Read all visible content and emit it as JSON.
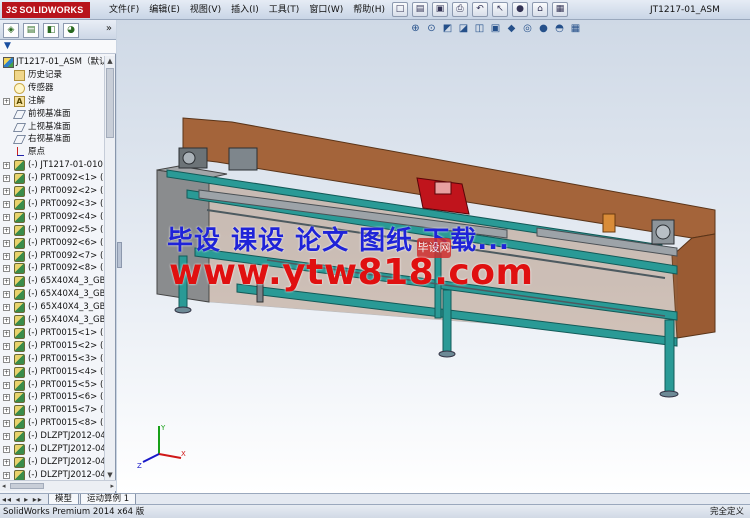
{
  "app": {
    "brand": "SOLIDWORKS",
    "doc_title": "JT1217-01_ASM"
  },
  "menu": [
    "文件(F)",
    "编辑(E)",
    "视图(V)",
    "插入(I)",
    "工具(T)",
    "窗口(W)",
    "帮助(H)"
  ],
  "title_toolbar": [
    {
      "icon": "new-document-icon",
      "glyph": "□"
    },
    {
      "icon": "open-folder-icon",
      "glyph": "▤"
    },
    {
      "icon": "save-icon",
      "glyph": "▣"
    },
    {
      "icon": "print-icon",
      "glyph": "⎙"
    },
    {
      "icon": "undo-icon",
      "glyph": "↶"
    },
    {
      "icon": "select-pointer-icon",
      "glyph": "↖"
    },
    {
      "icon": "traffic-light-icon",
      "glyph": "●"
    },
    {
      "icon": "rebuild-icon",
      "glyph": "⌂"
    },
    {
      "icon": "options-icon",
      "glyph": "▦"
    }
  ],
  "panel_tabs": [
    {
      "name": "feature-manager-tab",
      "glyph": "◈"
    },
    {
      "name": "property-manager-tab",
      "glyph": "▤"
    },
    {
      "name": "configuration-manager-tab",
      "glyph": "◧"
    },
    {
      "name": "appearance-tab",
      "glyph": "◕"
    }
  ],
  "panel_more": "»",
  "filter_glyph": "▼",
  "tree": [
    {
      "label": "JT1217-01_ASM（默认",
      "icon": "asm",
      "root": true
    },
    {
      "label": "历史记录",
      "icon": "folder"
    },
    {
      "label": "传感器",
      "icon": "sensor"
    },
    {
      "label": "注解",
      "icon": "anno",
      "expand": true
    },
    {
      "label": "前视基准面",
      "icon": "plane"
    },
    {
      "label": "上视基准面",
      "icon": "plane"
    },
    {
      "label": "右视基准面",
      "icon": "plane"
    },
    {
      "label": "原点",
      "icon": "origin"
    },
    {
      "label": "(-) JT1217-01-010",
      "icon": "part",
      "expand": true
    },
    {
      "label": "(-) PRT0092<1> (",
      "icon": "part",
      "expand": true
    },
    {
      "label": "(-) PRT0092<2> (",
      "icon": "part",
      "expand": true
    },
    {
      "label": "(-) PRT0092<3> (",
      "icon": "part",
      "expand": true
    },
    {
      "label": "(-) PRT0092<4> (",
      "icon": "part",
      "expand": true
    },
    {
      "label": "(-) PRT0092<5> (",
      "icon": "part",
      "expand": true
    },
    {
      "label": "(-) PRT0092<6> (",
      "icon": "part",
      "expand": true
    },
    {
      "label": "(-) PRT0092<7> (",
      "icon": "part",
      "expand": true
    },
    {
      "label": "(-) PRT0092<8> (",
      "icon": "part",
      "expand": true
    },
    {
      "label": "(-) 65X40X4_3_GB",
      "icon": "part",
      "expand": true
    },
    {
      "label": "(-) 65X40X4_3_GB",
      "icon": "part",
      "expand": true
    },
    {
      "label": "(-) 65X40X4_3_GB",
      "icon": "part",
      "expand": true
    },
    {
      "label": "(-) 65X40X4_3_GB",
      "icon": "part",
      "expand": true
    },
    {
      "label": "(-) PRT0015<1> (",
      "icon": "part",
      "expand": true
    },
    {
      "label": "(-) PRT0015<2> (",
      "icon": "part",
      "expand": true
    },
    {
      "label": "(-) PRT0015<3> (",
      "icon": "part",
      "expand": true
    },
    {
      "label": "(-) PRT0015<4> (",
      "icon": "part",
      "expand": true
    },
    {
      "label": "(-) PRT0015<5> (",
      "icon": "part",
      "expand": true
    },
    {
      "label": "(-) PRT0015<6> (",
      "icon": "part",
      "expand": true
    },
    {
      "label": "(-) PRT0015<7> (",
      "icon": "part",
      "expand": true
    },
    {
      "label": "(-) PRT0015<8> (",
      "icon": "part",
      "expand": true
    },
    {
      "label": "(-) DLZPTJ2012-04",
      "icon": "part",
      "expand": true
    },
    {
      "label": "(-) DLZPTJ2012-04",
      "icon": "part",
      "expand": true
    },
    {
      "label": "(-) DLZPTJ2012-04",
      "icon": "part",
      "expand": true
    },
    {
      "label": "(-) DLZPTJ2012-04",
      "icon": "part",
      "expand": true
    }
  ],
  "view_toolbar": [
    {
      "icon": "zoom-to-fit-icon",
      "glyph": "⊕"
    },
    {
      "icon": "zoom-area-icon",
      "glyph": "⊙"
    },
    {
      "icon": "previous-view-icon",
      "glyph": "◩"
    },
    {
      "icon": "section-view-icon",
      "glyph": "◪"
    },
    {
      "icon": "dynamic-annotation-icon",
      "glyph": "◫"
    },
    {
      "icon": "view-orientation-icon",
      "glyph": "▣"
    },
    {
      "icon": "display-style-icon",
      "glyph": "◆"
    },
    {
      "icon": "hide-show-items-icon",
      "glyph": "◎"
    },
    {
      "icon": "edit-appearance-icon",
      "glyph": "●"
    },
    {
      "icon": "apply-scene-icon",
      "glyph": "◓"
    },
    {
      "icon": "view-settings-icon",
      "glyph": "▦"
    }
  ],
  "watermark": {
    "line1": "毕设 课设 论文 图纸 下载...",
    "line2": "www.ytw818.com",
    "badge": "毕设网"
  },
  "bottom_tabs": {
    "nav": "◂◂ ◂ ▸ ▸▸",
    "tabs": [
      "模型",
      "运动算例 1"
    ]
  },
  "status": {
    "left": "SolidWorks Premium 2014 x64 版",
    "right": "完全定义"
  },
  "colors": {
    "frame_teal": "#2a9a96",
    "wood_brown": "#a4643a",
    "gray_panel": "#8a8c8e",
    "red_assembly": "#c0141c",
    "watermark_blue": "#1f23d8",
    "watermark_red": "#e01010"
  }
}
